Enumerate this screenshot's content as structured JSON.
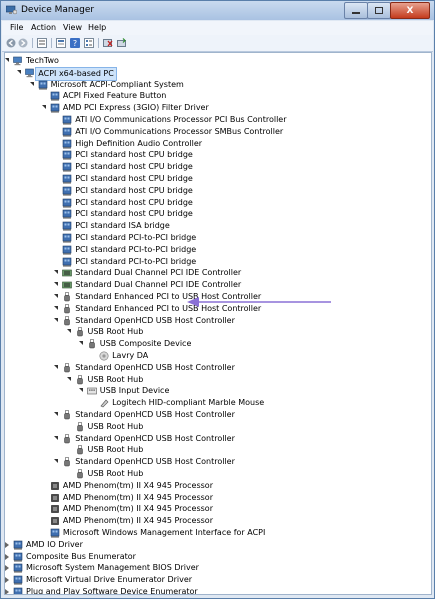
{
  "window": {
    "title": "Device Manager",
    "accent": "#a9c2e2"
  },
  "caption": {
    "close_label": "X"
  },
  "menu": [
    {
      "label": "File"
    },
    {
      "label": "Action"
    },
    {
      "label": "View"
    },
    {
      "label": "Help"
    }
  ],
  "toolbar": [
    {
      "icon": "back-arrow-icon"
    },
    {
      "icon": "forward-arrow-icon"
    },
    {
      "icon": "tree-view-icon"
    },
    {
      "icon": "properties-icon"
    },
    {
      "icon": "help-icon"
    },
    {
      "icon": "device-list-icon"
    },
    {
      "icon": "uninstall-icon"
    },
    {
      "icon": "scan-hardware-icon"
    }
  ],
  "tree": [
    {
      "label": "TechTwo",
      "level": 0,
      "exp": "open",
      "icon": "computer-icon"
    },
    {
      "label": "ACPI x64-based PC",
      "level": 1,
      "exp": "open",
      "icon": "computer-icon",
      "selected": true
    },
    {
      "label": "Microsoft ACPI-Compliant System",
      "level": 2,
      "exp": "open",
      "icon": "system-icon"
    },
    {
      "label": "ACPI Fixed Feature Button",
      "level": 3,
      "exp": "none",
      "icon": "system-icon"
    },
    {
      "label": "AMD PCI Express (3GIO) Filter Driver",
      "level": 3,
      "exp": "open",
      "icon": "system-icon"
    },
    {
      "label": "ATI I/O Communications Processor PCI Bus Controller",
      "level": 4,
      "exp": "none",
      "icon": "system-icon"
    },
    {
      "label": "ATI I/O Communications Processor SMBus Controller",
      "level": 4,
      "exp": "none",
      "icon": "system-icon"
    },
    {
      "label": "High Definition Audio Controller",
      "level": 4,
      "exp": "none",
      "icon": "system-icon"
    },
    {
      "label": "PCI standard host CPU bridge",
      "level": 4,
      "exp": "none",
      "icon": "system-icon"
    },
    {
      "label": "PCI standard host CPU bridge",
      "level": 4,
      "exp": "none",
      "icon": "system-icon"
    },
    {
      "label": "PCI standard host CPU bridge",
      "level": 4,
      "exp": "none",
      "icon": "system-icon"
    },
    {
      "label": "PCI standard host CPU bridge",
      "level": 4,
      "exp": "none",
      "icon": "system-icon"
    },
    {
      "label": "PCI standard host CPU bridge",
      "level": 4,
      "exp": "none",
      "icon": "system-icon"
    },
    {
      "label": "PCI standard host CPU bridge",
      "level": 4,
      "exp": "none",
      "icon": "system-icon"
    },
    {
      "label": "PCI standard ISA bridge",
      "level": 4,
      "exp": "none",
      "icon": "system-icon"
    },
    {
      "label": "PCI standard PCI-to-PCI bridge",
      "level": 4,
      "exp": "none",
      "icon": "system-icon"
    },
    {
      "label": "PCI standard PCI-to-PCI bridge",
      "level": 4,
      "exp": "none",
      "icon": "system-icon"
    },
    {
      "label": "PCI standard PCI-to-PCI bridge",
      "level": 4,
      "exp": "none",
      "icon": "system-icon"
    },
    {
      "label": "Standard Dual Channel PCI IDE Controller",
      "level": 4,
      "exp": "open",
      "icon": "ide-icon"
    },
    {
      "label": "Standard Dual Channel PCI IDE Controller",
      "level": 4,
      "exp": "open",
      "icon": "ide-icon"
    },
    {
      "label": "Standard Enhanced PCI to USB Host Controller",
      "level": 4,
      "exp": "open",
      "icon": "usb-icon"
    },
    {
      "label": "Standard Enhanced PCI to USB Host Controller",
      "level": 4,
      "exp": "open",
      "icon": "usb-icon"
    },
    {
      "label": "Standard OpenHCD USB Host Controller",
      "level": 4,
      "exp": "open",
      "icon": "usb-icon"
    },
    {
      "label": "USB Root Hub",
      "level": 5,
      "exp": "open",
      "icon": "usb-icon"
    },
    {
      "label": "USB Composite Device",
      "level": 6,
      "exp": "open",
      "icon": "usb-icon"
    },
    {
      "label": "Lavry  DA",
      "level": 7,
      "exp": "none",
      "icon": "audio-device-icon"
    },
    {
      "label": "Standard OpenHCD USB Host Controller",
      "level": 4,
      "exp": "open",
      "icon": "usb-icon"
    },
    {
      "label": "USB Root Hub",
      "level": 5,
      "exp": "open",
      "icon": "usb-icon"
    },
    {
      "label": "USB Input Device",
      "level": 6,
      "exp": "open",
      "icon": "hid-icon"
    },
    {
      "label": "Logitech HID-compliant Marble Mouse",
      "level": 7,
      "exp": "none",
      "icon": "mouse-icon"
    },
    {
      "label": "Standard OpenHCD USB Host Controller",
      "level": 4,
      "exp": "open",
      "icon": "usb-icon"
    },
    {
      "label": "USB Root Hub",
      "level": 5,
      "exp": "none",
      "icon": "usb-icon"
    },
    {
      "label": "Standard OpenHCD USB Host Controller",
      "level": 4,
      "exp": "open",
      "icon": "usb-icon"
    },
    {
      "label": "USB Root Hub",
      "level": 5,
      "exp": "none",
      "icon": "usb-icon"
    },
    {
      "label": "Standard OpenHCD USB Host Controller",
      "level": 4,
      "exp": "open",
      "icon": "usb-icon"
    },
    {
      "label": "USB Root Hub",
      "level": 5,
      "exp": "none",
      "icon": "usb-icon"
    },
    {
      "label": "AMD Phenom(tm) II X4 945 Processor",
      "level": 3,
      "exp": "none",
      "icon": "processor-icon"
    },
    {
      "label": "AMD Phenom(tm) II X4 945 Processor",
      "level": 3,
      "exp": "none",
      "icon": "processor-icon"
    },
    {
      "label": "AMD Phenom(tm) II X4 945 Processor",
      "level": 3,
      "exp": "none",
      "icon": "processor-icon"
    },
    {
      "label": "AMD Phenom(tm) II X4 945 Processor",
      "level": 3,
      "exp": "none",
      "icon": "processor-icon"
    },
    {
      "label": "Microsoft Windows Management Interface for ACPI",
      "level": 3,
      "exp": "none",
      "icon": "system-icon"
    },
    {
      "label": "AMD IO Driver",
      "level": 0,
      "exp": "closed",
      "icon": "system-icon"
    },
    {
      "label": "Composite Bus Enumerator",
      "level": 0,
      "exp": "closed",
      "icon": "system-icon"
    },
    {
      "label": "Microsoft System Management BIOS Driver",
      "level": 0,
      "exp": "closed",
      "icon": "system-icon"
    },
    {
      "label": "Microsoft Virtual Drive Enumerator Driver",
      "level": 0,
      "exp": "closed",
      "icon": "system-icon"
    },
    {
      "label": "Plug and Play Software Device Enumerator",
      "level": 0,
      "exp": "closed",
      "icon": "system-icon"
    }
  ],
  "colors": {
    "arrow": "#8a70d6",
    "selection": "#cde3fa"
  }
}
